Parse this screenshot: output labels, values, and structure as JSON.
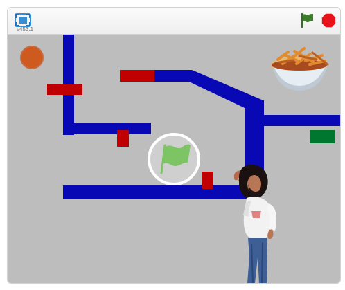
{
  "toolbar": {
    "version_label": "v453.1",
    "fullscreen_icon": "fullscreen-icon",
    "green_flag_icon": "green-flag-icon",
    "stop_icon": "stop-icon",
    "flag_color": "#3d7e2a",
    "stop_color": "#e9121b"
  },
  "stage": {
    "background_color": "#bdbdbe",
    "wall_color": "#0808b5",
    "red_block_color": "#c00000",
    "goal_color": "#00772e",
    "ball_color": "#cf5a1f",
    "center_flag_icon": "play-flag-overlay-icon",
    "sprites": [
      "orange-ball",
      "food-bowl",
      "person-character"
    ]
  }
}
